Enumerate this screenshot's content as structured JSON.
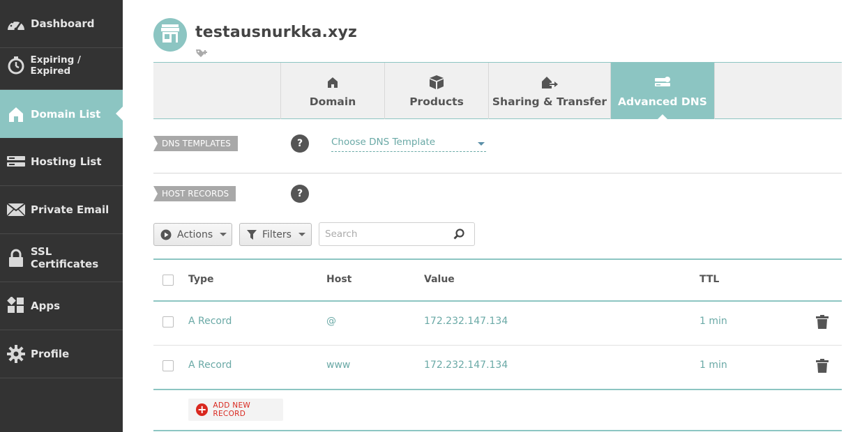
{
  "sidebar": {
    "items": [
      {
        "label": "Dashboard",
        "icon": "speedometer-icon"
      },
      {
        "label": "Expiring / Expired",
        "icon": "stopwatch-icon"
      },
      {
        "label": "Domain List",
        "icon": "home-icon",
        "active": true
      },
      {
        "label": "Hosting List",
        "icon": "server-icon"
      },
      {
        "label": "Private Email",
        "icon": "envelope-icon"
      },
      {
        "label": "SSL Certificates",
        "icon": "lock-icon"
      },
      {
        "label": "Apps",
        "icon": "apps-icon"
      },
      {
        "label": "Profile",
        "icon": "gear-icon"
      }
    ]
  },
  "header": {
    "domain": "testausnurkka.xyz",
    "avatar_icon": "storefront-icon",
    "tag_icon": "add-tag-icon"
  },
  "tabs": [
    {
      "label": "Domain",
      "icon": "home-icon"
    },
    {
      "label": "Products",
      "icon": "box-icon"
    },
    {
      "label": "Sharing & Transfer",
      "icon": "transfer-icon"
    },
    {
      "label": "Advanced DNS",
      "icon": "dns-icon",
      "active": true
    }
  ],
  "dns_templates": {
    "label": "DNS TEMPLATES",
    "help": "?",
    "select_value": "Choose DNS Template"
  },
  "host_records": {
    "label": "HOST RECORDS",
    "help": "?",
    "actions_label": "Actions",
    "filters_label": "Filters",
    "search_placeholder": "Search",
    "columns": {
      "type": "Type",
      "host": "Host",
      "value": "Value",
      "ttl": "TTL"
    },
    "rows": [
      {
        "type": "A Record",
        "host": "@",
        "value": "172.232.147.134",
        "ttl": "1 min"
      },
      {
        "type": "A Record",
        "host": "www",
        "value": "172.232.147.134",
        "ttl": "1 min"
      }
    ],
    "add_label": "ADD NEW RECORD",
    "add_plus": "+"
  },
  "colors": {
    "accent": "#8cc5c2",
    "sidebar_bg": "#333333",
    "link": "#6aa9a6",
    "danger": "#d9281f"
  }
}
